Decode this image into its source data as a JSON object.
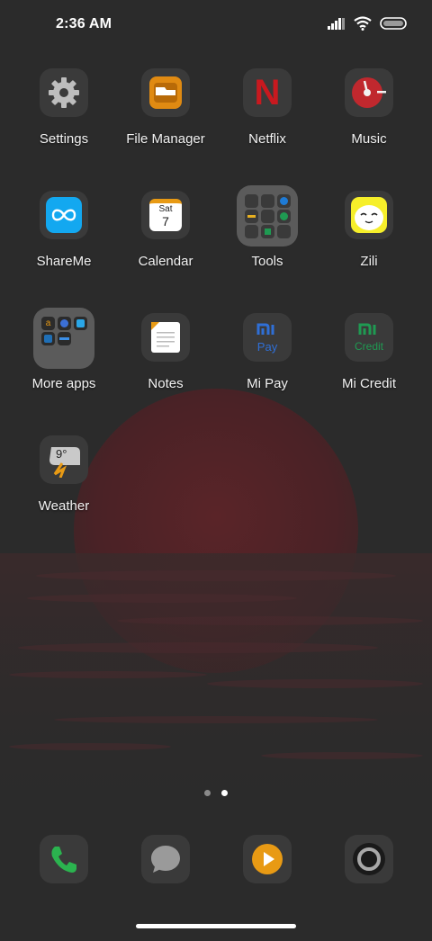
{
  "status_bar": {
    "time": "2:36 AM"
  },
  "apps": [
    {
      "name": "settings",
      "label": "Settings"
    },
    {
      "name": "file-manager",
      "label": "File Manager"
    },
    {
      "name": "netflix",
      "label": "Netflix",
      "glyph": "N"
    },
    {
      "name": "music",
      "label": "Music"
    },
    {
      "name": "shareme",
      "label": "ShareMe"
    },
    {
      "name": "calendar",
      "label": "Calendar",
      "day_name": "Sat",
      "day_number": "7"
    },
    {
      "name": "tools",
      "label": "Tools"
    },
    {
      "name": "zili",
      "label": "Zili"
    },
    {
      "name": "more-apps",
      "label": "More apps"
    },
    {
      "name": "notes",
      "label": "Notes"
    },
    {
      "name": "mi-pay",
      "label": "Mi Pay",
      "logo_text": "Pay"
    },
    {
      "name": "mi-credit",
      "label": "Mi Credit",
      "logo_text": "Credit"
    },
    {
      "name": "weather",
      "label": "Weather",
      "temperature": "9°"
    }
  ],
  "page_indicator": {
    "pages": 2,
    "active_page": 2
  },
  "dock": [
    {
      "name": "phone",
      "icon": "phone-icon"
    },
    {
      "name": "messages",
      "icon": "message-icon"
    },
    {
      "name": "video-player",
      "icon": "play-icon"
    },
    {
      "name": "camera",
      "icon": "camera-icon"
    }
  ],
  "colors": {
    "background": "#2b2b2b",
    "tile": "#3a3a3a",
    "folder_tile": "#5b5b5b",
    "netflix_red": "#c8191f",
    "file_manager_orange": "#e08a12",
    "shareme_blue": "#13a8f0",
    "mi_pay_blue": "#2f6fd6",
    "mi_credit_green": "#1f9a52",
    "phone_green": "#2bb34f",
    "player_orange": "#e89a14",
    "zili_yellow": "#f6ef2a"
  }
}
